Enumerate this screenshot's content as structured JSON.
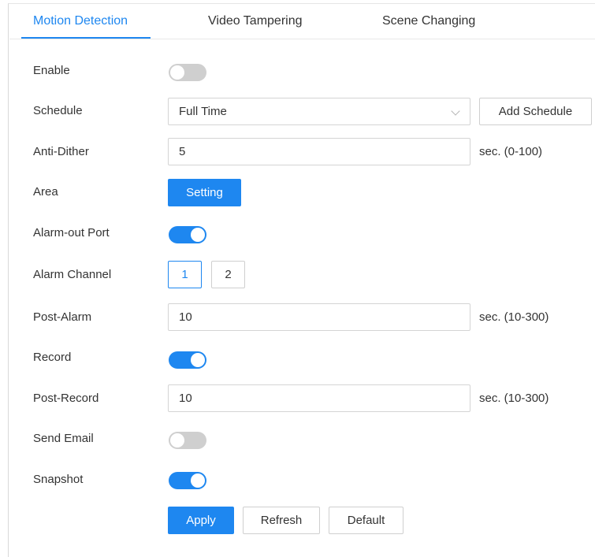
{
  "tabs": [
    {
      "label": "Motion Detection",
      "active": true
    },
    {
      "label": "Video Tampering",
      "active": false
    },
    {
      "label": "Scene Changing",
      "active": false
    }
  ],
  "form": {
    "enable": {
      "label": "Enable",
      "on": false
    },
    "schedule": {
      "label": "Schedule",
      "value": "Full Time",
      "add_button": "Add Schedule"
    },
    "anti_dither": {
      "label": "Anti-Dither",
      "value": "5",
      "unit": "sec. (0-100)"
    },
    "area": {
      "label": "Area",
      "button": "Setting"
    },
    "alarm_out_port": {
      "label": "Alarm-out Port",
      "on": true
    },
    "alarm_channel": {
      "label": "Alarm Channel",
      "options": [
        "1",
        "2"
      ],
      "selected": "1"
    },
    "post_alarm": {
      "label": "Post-Alarm",
      "value": "10",
      "unit": "sec. (10-300)"
    },
    "record": {
      "label": "Record",
      "on": true
    },
    "post_record": {
      "label": "Post-Record",
      "value": "10",
      "unit": "sec. (10-300)"
    },
    "send_email": {
      "label": "Send Email",
      "on": false
    },
    "snapshot": {
      "label": "Snapshot",
      "on": true
    }
  },
  "actions": {
    "apply": "Apply",
    "refresh": "Refresh",
    "default": "Default"
  },
  "colors": {
    "accent": "#1e87f0",
    "switch_off": "#cfcfcf",
    "border": "#d4d4d4"
  }
}
